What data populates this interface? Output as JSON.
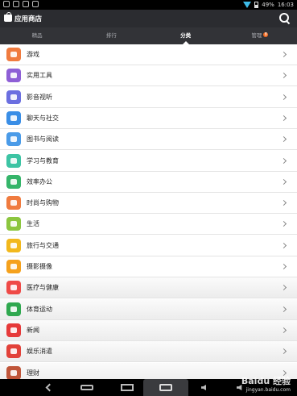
{
  "status_bar": {
    "battery": "49%",
    "time": "16:03"
  },
  "app": {
    "title": "应用商店"
  },
  "tabs": [
    {
      "label": "精品"
    },
    {
      "label": "排行"
    },
    {
      "label": "分类"
    },
    {
      "label": "管理",
      "badge": "8"
    }
  ],
  "categories": [
    {
      "label": "游戏",
      "icon": "gamepad-icon",
      "color": "#f07b3f"
    },
    {
      "label": "实用工具",
      "icon": "wrench-icon",
      "color": "#8e5fd6"
    },
    {
      "label": "影音视听",
      "icon": "headphones-icon",
      "color": "#6b6fe0"
    },
    {
      "label": "聊天与社交",
      "icon": "chat-icon",
      "color": "#3a8ee6"
    },
    {
      "label": "图书与阅读",
      "icon": "book-icon",
      "color": "#4a9be8"
    },
    {
      "label": "学习与教育",
      "icon": "flask-icon",
      "color": "#3dc4a4"
    },
    {
      "label": "效率办公",
      "icon": "calendar-icon",
      "color": "#35b56a"
    },
    {
      "label": "时尚与购物",
      "icon": "shopping-bag-icon",
      "color": "#f07b3f"
    },
    {
      "label": "生活",
      "icon": "paper-plane-icon",
      "color": "#8cc63f"
    },
    {
      "label": "旅行与交通",
      "icon": "suitcase-icon",
      "color": "#f2b81c"
    },
    {
      "label": "摄影摄像",
      "icon": "camcorder-icon",
      "color": "#f5a11c"
    },
    {
      "label": "医疗与健康",
      "icon": "heart-icon",
      "color": "#ef4a47"
    },
    {
      "label": "体育运动",
      "icon": "sport-flag-icon",
      "color": "#2fa84f"
    },
    {
      "label": "新闻",
      "icon": "newspaper-icon",
      "color": "#e63a3a"
    },
    {
      "label": "娱乐消遣",
      "icon": "microphone-icon",
      "color": "#e2423a"
    },
    {
      "label": "理财",
      "icon": "money-icon",
      "color": "#c0563a"
    }
  ],
  "watermark": {
    "brand": "Baidu 经验",
    "url": "jingyan.baidu.com"
  }
}
